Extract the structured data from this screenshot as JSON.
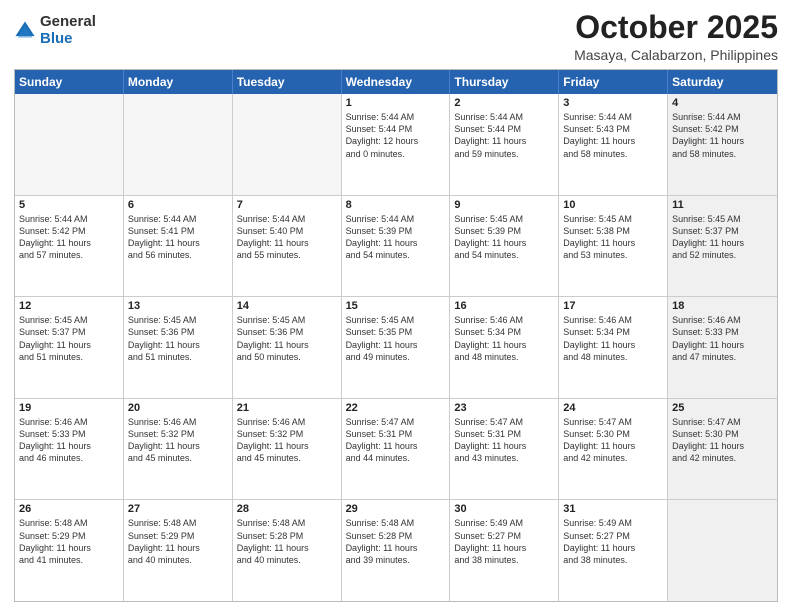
{
  "logo": {
    "general": "General",
    "blue": "Blue"
  },
  "title": "October 2025",
  "location": "Masaya, Calabarzon, Philippines",
  "days_of_week": [
    "Sunday",
    "Monday",
    "Tuesday",
    "Wednesday",
    "Thursday",
    "Friday",
    "Saturday"
  ],
  "weeks": [
    [
      {
        "day": "",
        "info": "",
        "empty": true
      },
      {
        "day": "",
        "info": "",
        "empty": true
      },
      {
        "day": "",
        "info": "",
        "empty": true
      },
      {
        "day": "1",
        "info": "Sunrise: 5:44 AM\nSunset: 5:44 PM\nDaylight: 12 hours\nand 0 minutes."
      },
      {
        "day": "2",
        "info": "Sunrise: 5:44 AM\nSunset: 5:44 PM\nDaylight: 11 hours\nand 59 minutes."
      },
      {
        "day": "3",
        "info": "Sunrise: 5:44 AM\nSunset: 5:43 PM\nDaylight: 11 hours\nand 58 minutes."
      },
      {
        "day": "4",
        "info": "Sunrise: 5:44 AM\nSunset: 5:42 PM\nDaylight: 11 hours\nand 58 minutes.",
        "shaded": true
      }
    ],
    [
      {
        "day": "5",
        "info": "Sunrise: 5:44 AM\nSunset: 5:42 PM\nDaylight: 11 hours\nand 57 minutes."
      },
      {
        "day": "6",
        "info": "Sunrise: 5:44 AM\nSunset: 5:41 PM\nDaylight: 11 hours\nand 56 minutes."
      },
      {
        "day": "7",
        "info": "Sunrise: 5:44 AM\nSunset: 5:40 PM\nDaylight: 11 hours\nand 55 minutes."
      },
      {
        "day": "8",
        "info": "Sunrise: 5:44 AM\nSunset: 5:39 PM\nDaylight: 11 hours\nand 54 minutes."
      },
      {
        "day": "9",
        "info": "Sunrise: 5:45 AM\nSunset: 5:39 PM\nDaylight: 11 hours\nand 54 minutes."
      },
      {
        "day": "10",
        "info": "Sunrise: 5:45 AM\nSunset: 5:38 PM\nDaylight: 11 hours\nand 53 minutes."
      },
      {
        "day": "11",
        "info": "Sunrise: 5:45 AM\nSunset: 5:37 PM\nDaylight: 11 hours\nand 52 minutes.",
        "shaded": true
      }
    ],
    [
      {
        "day": "12",
        "info": "Sunrise: 5:45 AM\nSunset: 5:37 PM\nDaylight: 11 hours\nand 51 minutes."
      },
      {
        "day": "13",
        "info": "Sunrise: 5:45 AM\nSunset: 5:36 PM\nDaylight: 11 hours\nand 51 minutes."
      },
      {
        "day": "14",
        "info": "Sunrise: 5:45 AM\nSunset: 5:36 PM\nDaylight: 11 hours\nand 50 minutes."
      },
      {
        "day": "15",
        "info": "Sunrise: 5:45 AM\nSunset: 5:35 PM\nDaylight: 11 hours\nand 49 minutes."
      },
      {
        "day": "16",
        "info": "Sunrise: 5:46 AM\nSunset: 5:34 PM\nDaylight: 11 hours\nand 48 minutes."
      },
      {
        "day": "17",
        "info": "Sunrise: 5:46 AM\nSunset: 5:34 PM\nDaylight: 11 hours\nand 48 minutes."
      },
      {
        "day": "18",
        "info": "Sunrise: 5:46 AM\nSunset: 5:33 PM\nDaylight: 11 hours\nand 47 minutes.",
        "shaded": true
      }
    ],
    [
      {
        "day": "19",
        "info": "Sunrise: 5:46 AM\nSunset: 5:33 PM\nDaylight: 11 hours\nand 46 minutes."
      },
      {
        "day": "20",
        "info": "Sunrise: 5:46 AM\nSunset: 5:32 PM\nDaylight: 11 hours\nand 45 minutes."
      },
      {
        "day": "21",
        "info": "Sunrise: 5:46 AM\nSunset: 5:32 PM\nDaylight: 11 hours\nand 45 minutes."
      },
      {
        "day": "22",
        "info": "Sunrise: 5:47 AM\nSunset: 5:31 PM\nDaylight: 11 hours\nand 44 minutes."
      },
      {
        "day": "23",
        "info": "Sunrise: 5:47 AM\nSunset: 5:31 PM\nDaylight: 11 hours\nand 43 minutes."
      },
      {
        "day": "24",
        "info": "Sunrise: 5:47 AM\nSunset: 5:30 PM\nDaylight: 11 hours\nand 42 minutes."
      },
      {
        "day": "25",
        "info": "Sunrise: 5:47 AM\nSunset: 5:30 PM\nDaylight: 11 hours\nand 42 minutes.",
        "shaded": true
      }
    ],
    [
      {
        "day": "26",
        "info": "Sunrise: 5:48 AM\nSunset: 5:29 PM\nDaylight: 11 hours\nand 41 minutes."
      },
      {
        "day": "27",
        "info": "Sunrise: 5:48 AM\nSunset: 5:29 PM\nDaylight: 11 hours\nand 40 minutes."
      },
      {
        "day": "28",
        "info": "Sunrise: 5:48 AM\nSunset: 5:28 PM\nDaylight: 11 hours\nand 40 minutes."
      },
      {
        "day": "29",
        "info": "Sunrise: 5:48 AM\nSunset: 5:28 PM\nDaylight: 11 hours\nand 39 minutes."
      },
      {
        "day": "30",
        "info": "Sunrise: 5:49 AM\nSunset: 5:27 PM\nDaylight: 11 hours\nand 38 minutes."
      },
      {
        "day": "31",
        "info": "Sunrise: 5:49 AM\nSunset: 5:27 PM\nDaylight: 11 hours\nand 38 minutes."
      },
      {
        "day": "",
        "info": "",
        "empty": true,
        "shaded": true
      }
    ]
  ]
}
